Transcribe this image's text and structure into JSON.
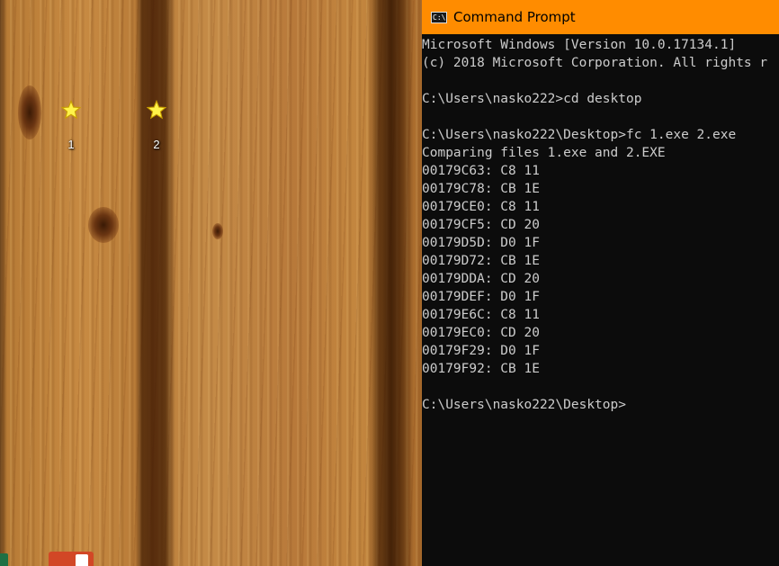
{
  "desktop": {
    "icons": [
      {
        "label": "1",
        "icon": "star-icon"
      },
      {
        "label": "2",
        "icon": "star-icon"
      }
    ],
    "taskbar_fragments": [
      "excel-icon",
      "powerpoint-icon"
    ]
  },
  "cmd": {
    "title": "Command Prompt",
    "colors": {
      "titlebar": "#ff8c00",
      "background": "#0c0c0c",
      "text": "#cccccc"
    },
    "lines": [
      "Microsoft Windows [Version 10.0.17134.1]",
      "(c) 2018 Microsoft Corporation. All rights r",
      "",
      "C:\\Users\\nasko222>cd desktop",
      "",
      "C:\\Users\\nasko222\\Desktop>fc 1.exe 2.exe",
      "Comparing files 1.exe and 2.EXE",
      "00179C63: C8 11",
      "00179C78: CB 1E",
      "00179CE0: C8 11",
      "00179CF5: CD 20",
      "00179D5D: D0 1F",
      "00179D72: CB 1E",
      "00179DDA: CD 20",
      "00179DEF: D0 1F",
      "00179E6C: C8 11",
      "00179EC0: CD 20",
      "00179F29: D0 1F",
      "00179F92: CB 1E",
      "",
      "C:\\Users\\nasko222\\Desktop>"
    ]
  }
}
